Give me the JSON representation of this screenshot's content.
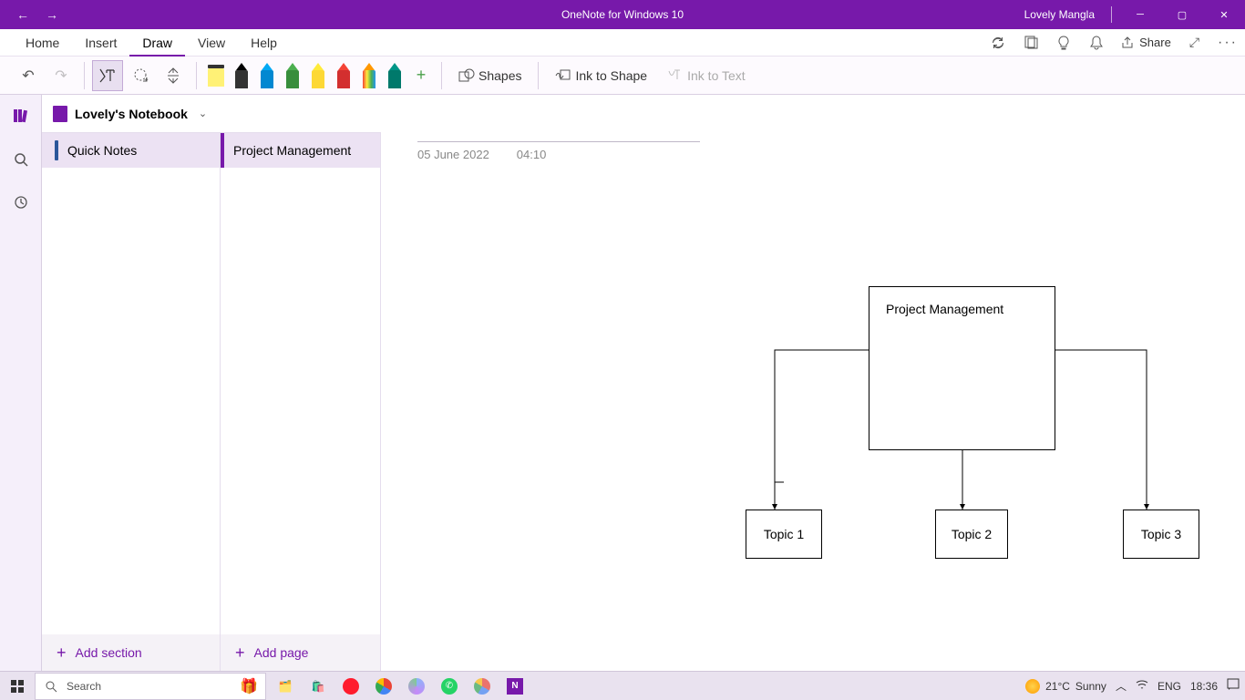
{
  "titlebar": {
    "app": "OneNote for Windows 10",
    "user": "Lovely Mangla"
  },
  "menu": {
    "items": [
      "Home",
      "Insert",
      "Draw",
      "View",
      "Help"
    ],
    "active": 2,
    "share": "Share"
  },
  "ribbon": {
    "shapes": "Shapes",
    "ink_to_shape": "Ink to Shape",
    "ink_to_text": "Ink to Text"
  },
  "notebook": {
    "name": "Lovely's Notebook"
  },
  "sections": {
    "items": [
      "Quick Notes"
    ],
    "selected": 0,
    "add": "Add section"
  },
  "pages": {
    "items": [
      "Project Management"
    ],
    "selected": 0,
    "add": "Add page"
  },
  "page": {
    "date": "05 June 2022",
    "time": "04:10"
  },
  "diagram": {
    "main": "Project Management",
    "topics": [
      "Topic 1",
      "Topic 2",
      "Topic 3"
    ]
  },
  "taskbar": {
    "search_placeholder": "Search",
    "weather_temp": "21°C",
    "weather_cond": "Sunny",
    "lang": "ENG",
    "time": "18:36"
  }
}
